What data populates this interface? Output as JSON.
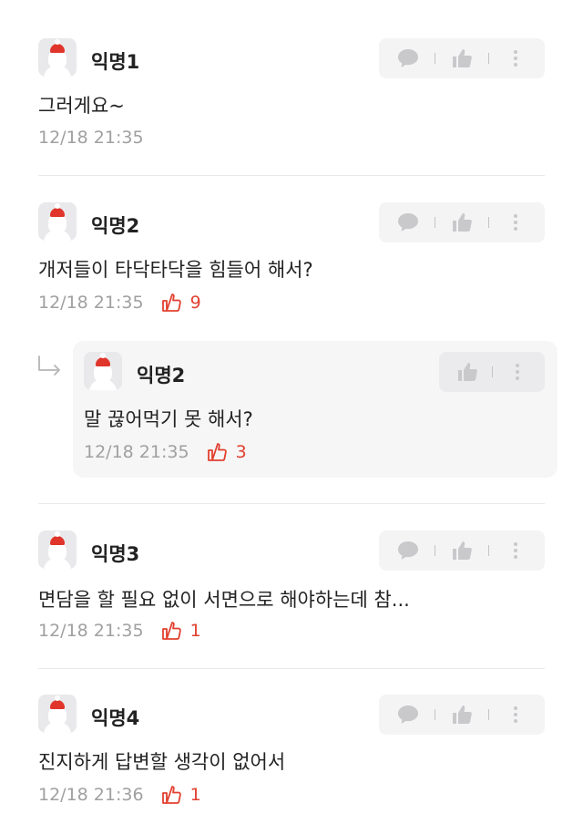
{
  "comments": [
    {
      "author": "익명1",
      "text": "그러게요~",
      "time": "12/18 21:35",
      "likes": ""
    },
    {
      "author": "익명2",
      "text": "개저들이 타닥타닥을 힘들어 해서?",
      "time": "12/18 21:35",
      "likes": "9"
    },
    {
      "author": "익명3",
      "text": "면담을 할 필요 없이 서면으로 해야하는데 참...",
      "time": "12/18 21:35",
      "likes": "1"
    },
    {
      "author": "익명4",
      "text": "진지하게 답변할 생각이 없어서",
      "time": "12/18 21:36",
      "likes": "1"
    }
  ],
  "reply": {
    "author": "익명2",
    "text": "말 끊어먹기 못 해서?",
    "time": "12/18 21:35",
    "likes": "3"
  },
  "icons": {
    "reply": "speech-bubble-icon",
    "like": "thumbs-up-icon",
    "more": "vertical-dots-icon",
    "reply_indicator": "reply-arrow-icon"
  },
  "colors": {
    "accent": "#e2402f",
    "meta": "#a0a0a0",
    "action_bg": "#f4f4f5"
  }
}
